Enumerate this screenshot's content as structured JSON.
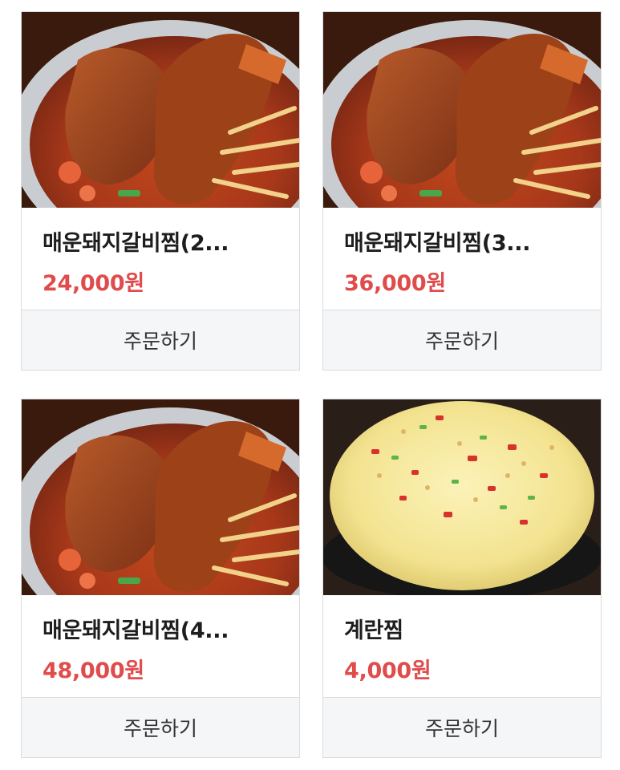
{
  "theme": {
    "price_color": "#e04b4b",
    "button_bg": "#f5f6f8"
  },
  "products": [
    {
      "name": "매운돼지갈비찜(2...",
      "price": "24,000원",
      "button": "주문하기",
      "image": "braised-spicy-pork-ribs-photo"
    },
    {
      "name": "매운돼지갈비찜(3...",
      "price": "36,000원",
      "button": "주문하기",
      "image": "braised-spicy-pork-ribs-photo"
    },
    {
      "name": "매운돼지갈비찜(4...",
      "price": "48,000원",
      "button": "주문하기",
      "image": "braised-spicy-pork-ribs-photo"
    },
    {
      "name": "계란찜",
      "price": "4,000원",
      "button": "주문하기",
      "image": "steamed-egg-photo"
    }
  ]
}
